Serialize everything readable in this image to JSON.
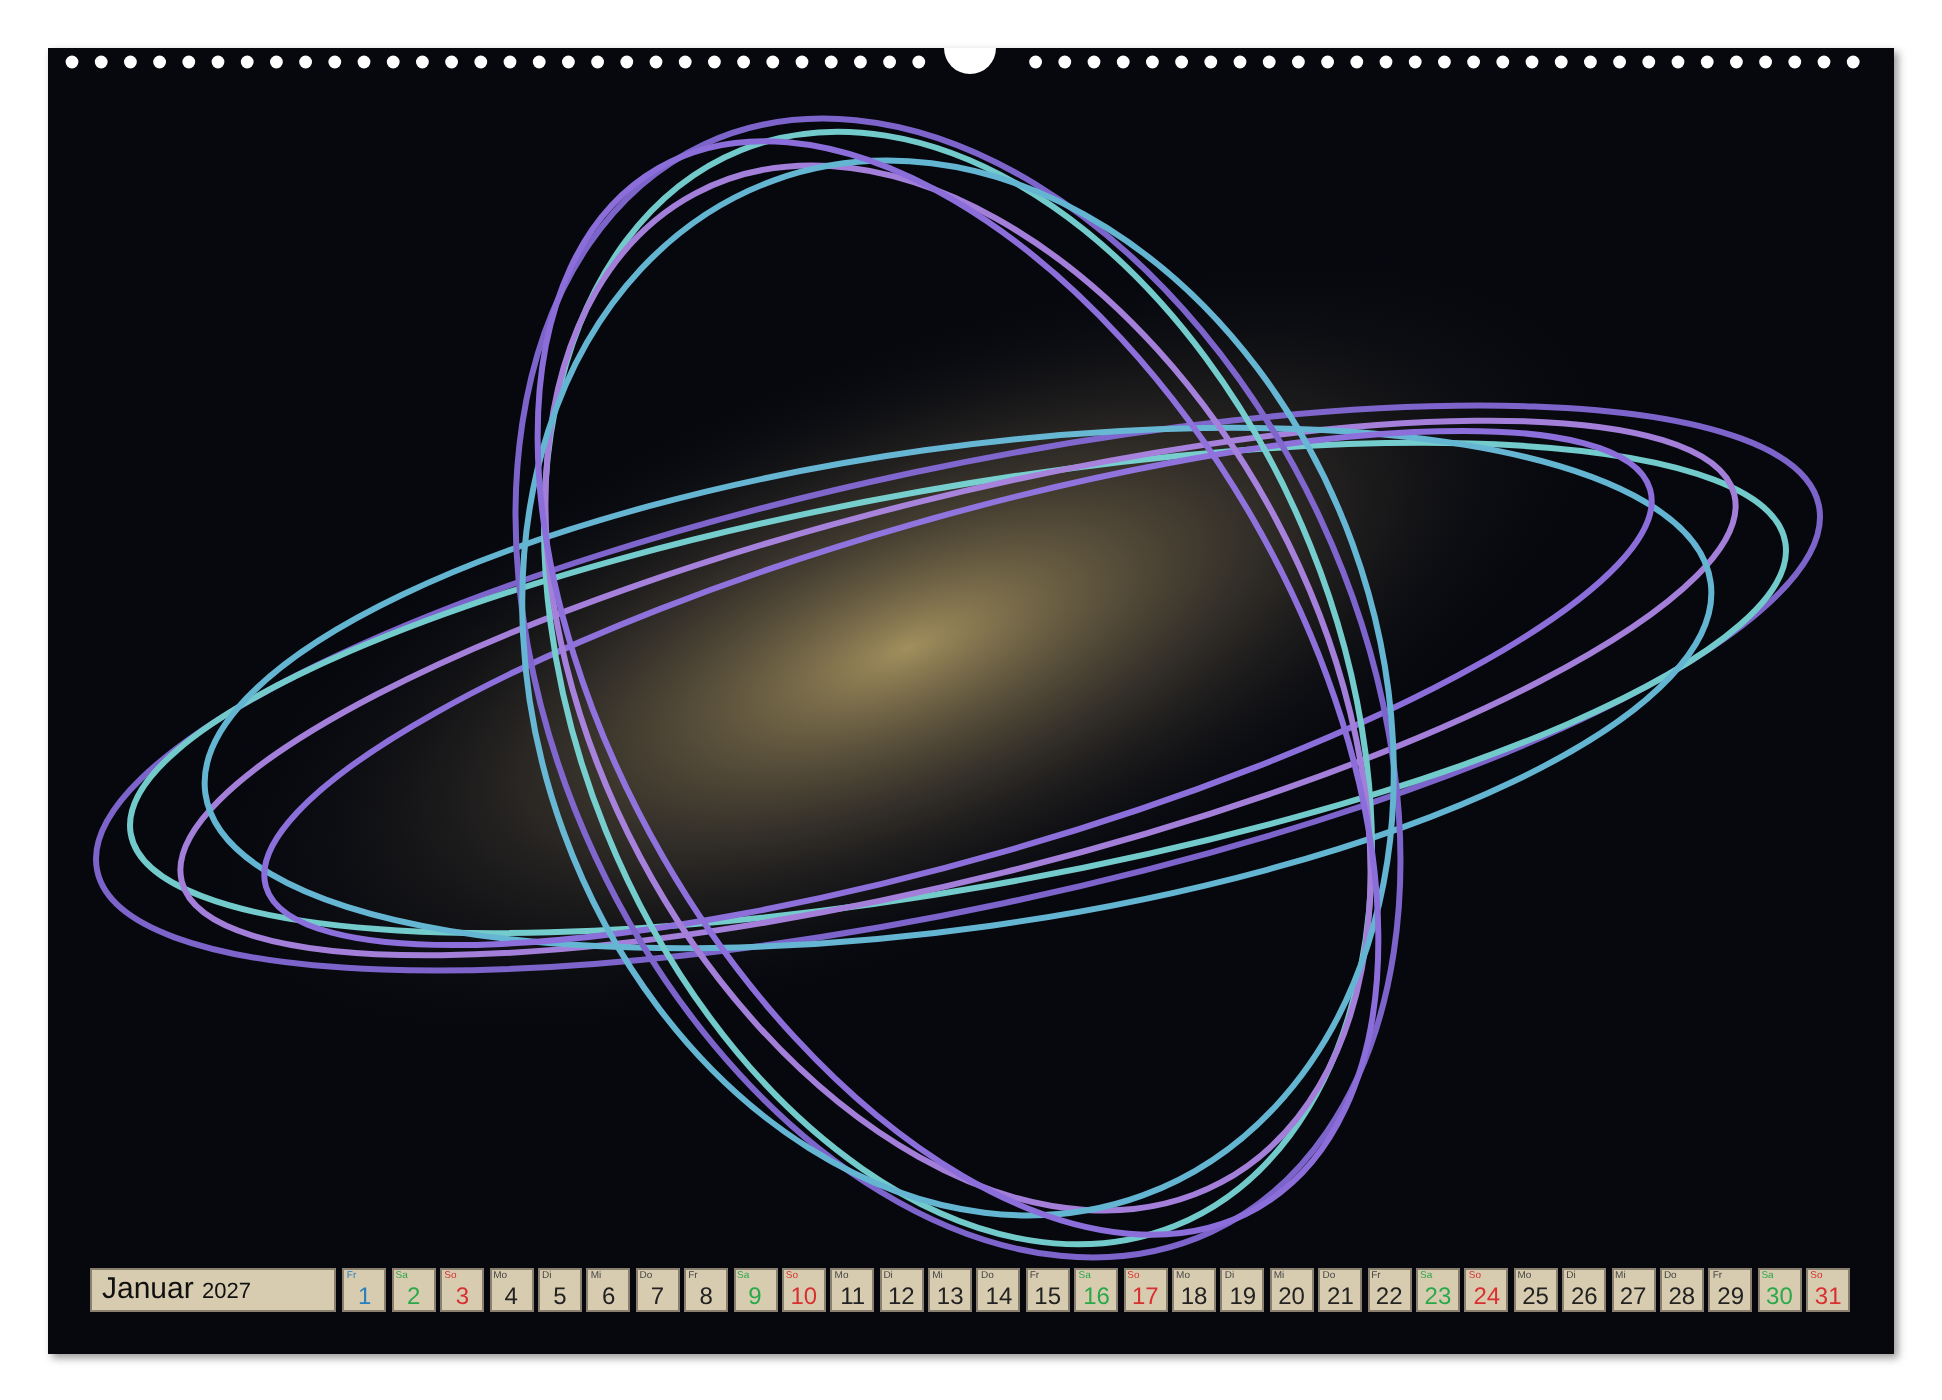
{
  "calendar": {
    "month": "Januar",
    "year": "2027",
    "days": [
      {
        "weekday": "Fr",
        "day": "1",
        "kind": "holiday"
      },
      {
        "weekday": "Sa",
        "day": "2",
        "kind": "saturday"
      },
      {
        "weekday": "So",
        "day": "3",
        "kind": "sunday"
      },
      {
        "weekday": "Mo",
        "day": "4",
        "kind": "weekday"
      },
      {
        "weekday": "Di",
        "day": "5",
        "kind": "weekday"
      },
      {
        "weekday": "Mi",
        "day": "6",
        "kind": "weekday"
      },
      {
        "weekday": "Do",
        "day": "7",
        "kind": "weekday"
      },
      {
        "weekday": "Fr",
        "day": "8",
        "kind": "weekday"
      },
      {
        "weekday": "Sa",
        "day": "9",
        "kind": "saturday"
      },
      {
        "weekday": "So",
        "day": "10",
        "kind": "sunday"
      },
      {
        "weekday": "Mo",
        "day": "11",
        "kind": "weekday"
      },
      {
        "weekday": "Di",
        "day": "12",
        "kind": "weekday"
      },
      {
        "weekday": "Mi",
        "day": "13",
        "kind": "weekday"
      },
      {
        "weekday": "Do",
        "day": "14",
        "kind": "weekday"
      },
      {
        "weekday": "Fr",
        "day": "15",
        "kind": "weekday"
      },
      {
        "weekday": "Sa",
        "day": "16",
        "kind": "saturday"
      },
      {
        "weekday": "So",
        "day": "17",
        "kind": "sunday"
      },
      {
        "weekday": "Mo",
        "day": "18",
        "kind": "weekday"
      },
      {
        "weekday": "Di",
        "day": "19",
        "kind": "weekday"
      },
      {
        "weekday": "Mi",
        "day": "20",
        "kind": "weekday"
      },
      {
        "weekday": "Do",
        "day": "21",
        "kind": "weekday"
      },
      {
        "weekday": "Fr",
        "day": "22",
        "kind": "weekday"
      },
      {
        "weekday": "Sa",
        "day": "23",
        "kind": "saturday"
      },
      {
        "weekday": "So",
        "day": "24",
        "kind": "sunday"
      },
      {
        "weekday": "Mo",
        "day": "25",
        "kind": "weekday"
      },
      {
        "weekday": "Di",
        "day": "26",
        "kind": "weekday"
      },
      {
        "weekday": "Mi",
        "day": "27",
        "kind": "weekday"
      },
      {
        "weekday": "Do",
        "day": "28",
        "kind": "weekday"
      },
      {
        "weekday": "Fr",
        "day": "29",
        "kind": "weekday"
      },
      {
        "weekday": "Sa",
        "day": "30",
        "kind": "saturday"
      },
      {
        "weekday": "So",
        "day": "31",
        "kind": "sunday"
      }
    ]
  }
}
